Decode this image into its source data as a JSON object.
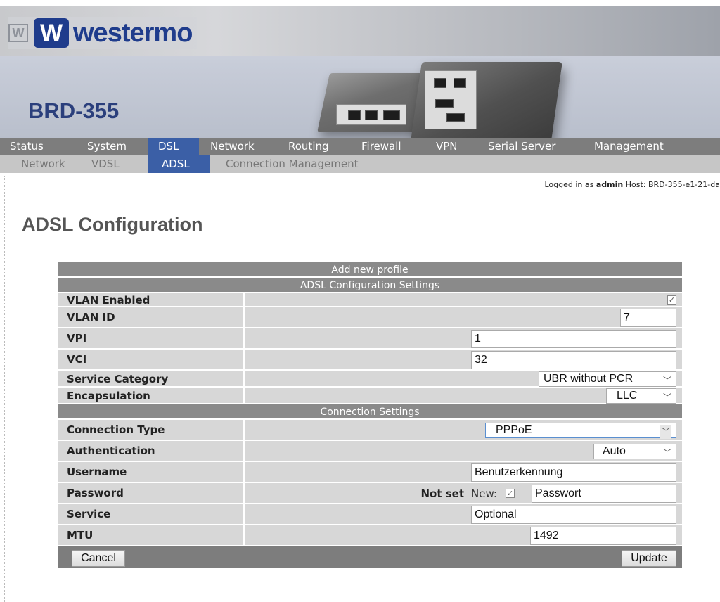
{
  "brand": {
    "logo_text": "westermo",
    "product": "BRD-355"
  },
  "nav": {
    "main": [
      "Status",
      "System",
      "DSL",
      "Network",
      "Routing",
      "Firewall",
      "VPN",
      "Serial Server",
      "Management"
    ],
    "sub": [
      "Network",
      "VDSL",
      "ADSL",
      "Connection Management"
    ],
    "active_main": "DSL",
    "active_sub": "ADSL"
  },
  "session": {
    "logged_in_prefix": "Logged in as",
    "user": "admin",
    "host_text": "Host: BRD-355-e1-21-da"
  },
  "page_title": "ADSL Configuration",
  "form": {
    "header": "Add new profile",
    "section1": "ADSL Configuration Settings",
    "section2": "Connection Settings",
    "vlan_enabled": {
      "label": "VLAN Enabled",
      "checked": true
    },
    "vlan_id": {
      "label": "VLAN ID",
      "value": "7"
    },
    "vpi": {
      "label": "VPI",
      "value": "1"
    },
    "vci": {
      "label": "VCI",
      "value": "32"
    },
    "service_category": {
      "label": "Service Category",
      "value": "UBR without PCR"
    },
    "encapsulation": {
      "label": "Encapsulation",
      "value": "LLC"
    },
    "connection_type": {
      "label": "Connection Type",
      "value": "PPPoE"
    },
    "authentication": {
      "label": "Authentication",
      "value": "Auto"
    },
    "username": {
      "label": "Username",
      "value": "Benutzerkennung"
    },
    "password": {
      "label": "Password",
      "status": "Not set",
      "new_label": "New:",
      "new_checked": true,
      "value": "Passwort"
    },
    "service": {
      "label": "Service",
      "value": "Optional"
    },
    "mtu": {
      "label": "MTU",
      "value": "1492"
    }
  },
  "buttons": {
    "cancel": "Cancel",
    "update": "Update"
  },
  "colors": {
    "nav_active": "#3b5fa6",
    "brand_blue": "#1f3c8c",
    "table_header": "#8a8a8a"
  }
}
